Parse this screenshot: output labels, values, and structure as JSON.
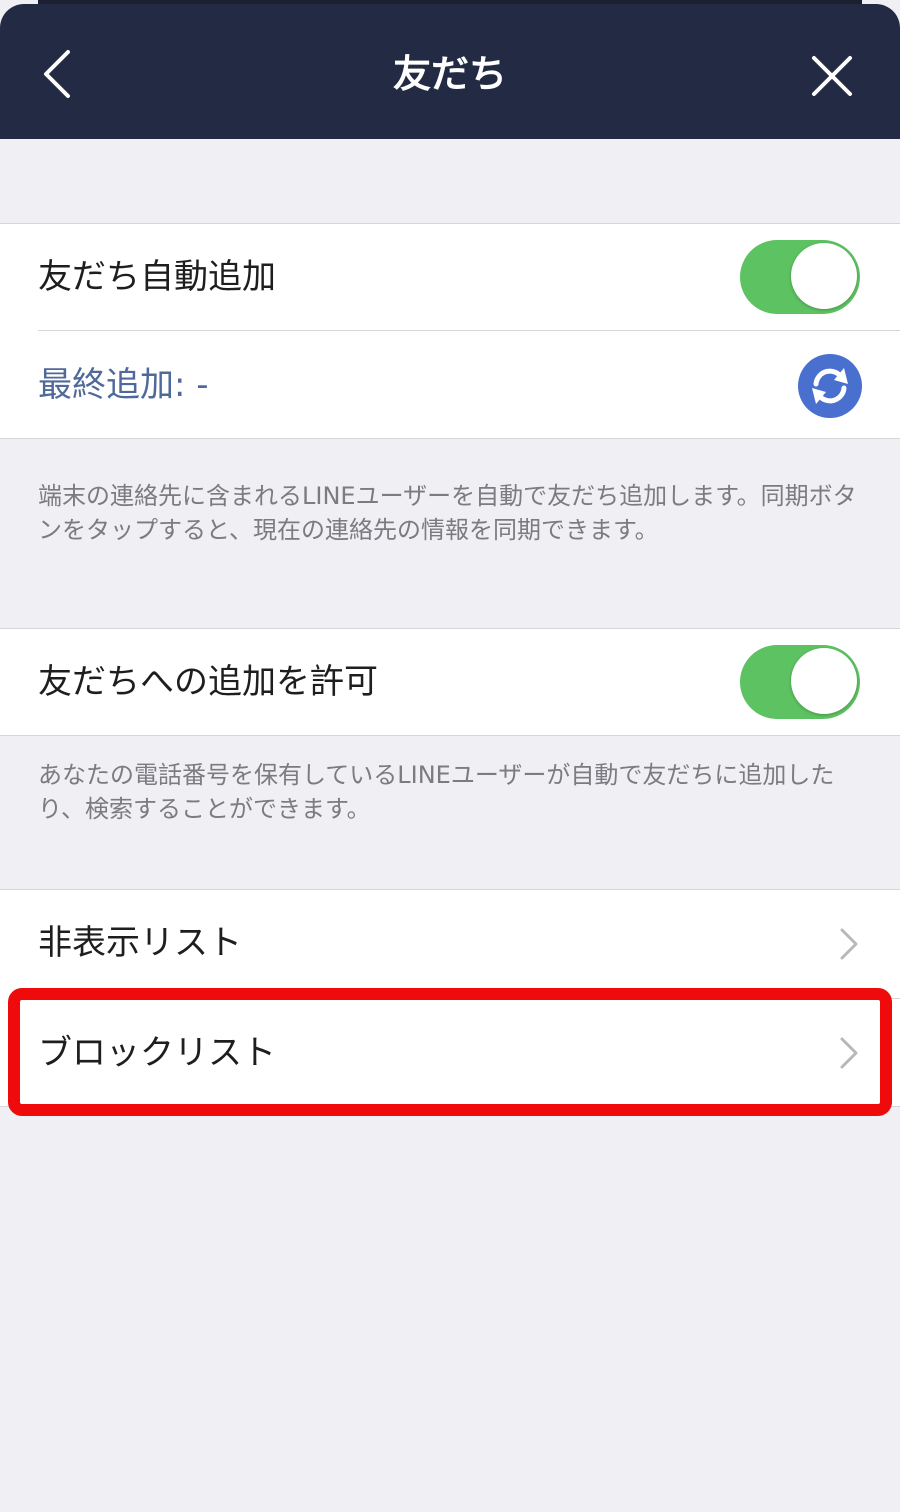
{
  "header": {
    "title": "友だち",
    "back_icon": "chevron-left-icon",
    "close_icon": "close-icon"
  },
  "auto_add": {
    "label": "友だち自動追加",
    "enabled": true,
    "last_added_label": "最終追加: -",
    "sync_icon": "sync-icon",
    "note": "端末の連絡先に含まれるLINEユーザーを自動で友だち追加します。同期ボタンをタップすると、現在の連絡先の情報を同期できます。"
  },
  "allow_add": {
    "label": "友だちへの追加を許可",
    "enabled": true,
    "note": "あなたの電話番号を保有しているLINEユーザーが自動で友だちに追加したり、検索することができます。"
  },
  "lists": {
    "hidden_label": "非表示リスト",
    "blocked_label": "ブロックリスト"
  },
  "colors": {
    "header_bg": "#232a43",
    "toggle_on": "#5dc262",
    "sync_button": "#4a70cf",
    "highlight": "#ef0b0b"
  }
}
